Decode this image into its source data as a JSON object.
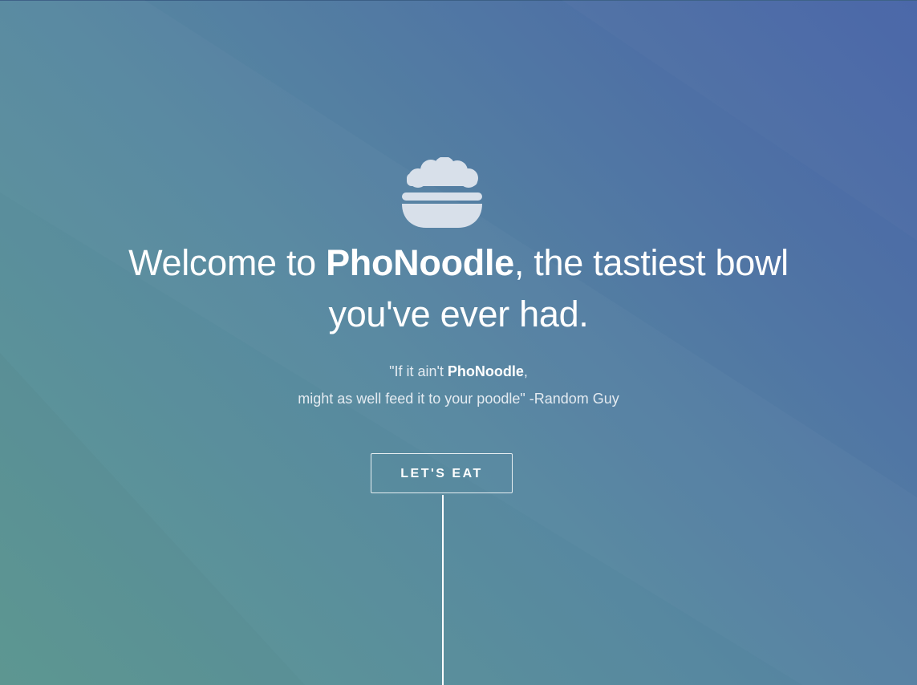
{
  "hero": {
    "headline": {
      "prefix": "Welcome to ",
      "brand": "PhoNoodle",
      "suffix": ", the tastiest bowl you've ever had."
    },
    "quote": {
      "open": "\"If it ain't ",
      "brand": "PhoNoodle",
      "comma": ",",
      "line2": "might as well feed it to your poodle\" -Random Guy"
    },
    "cta_label": "LET'S EAT",
    "icon": "noodle-bowl-icon"
  },
  "colors": {
    "gradient_start": "#5f9a94",
    "gradient_end": "#4865a8",
    "text": "#ffffff",
    "icon_fill": "#d8e0ea"
  }
}
